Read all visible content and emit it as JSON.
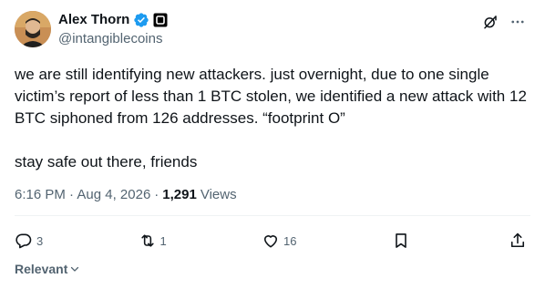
{
  "author": {
    "display_name": "Alex Thorn",
    "handle": "@intangiblecoins",
    "verified": true,
    "avatar_icon": "avatar-photo"
  },
  "tweet": {
    "paragraphs": [
      "we are still identifying new attackers. just overnight, due to one single victim’s report of less than 1 BTC stolen, we identified a new attack with 12 BTC siphoned from 126 addresses. “footprint O”",
      "stay safe out there, friends"
    ],
    "time": "6:16 PM",
    "date": "Aug 4, 2026",
    "separator": "·",
    "views_count": "1,291",
    "views_label": "Views"
  },
  "actions": {
    "replies": "3",
    "reposts": "1",
    "likes": "16"
  },
  "sort": {
    "label": "Relevant"
  },
  "colors": {
    "text": "#0f1419",
    "secondary": "#536471",
    "verified": "#1d9bf0",
    "divider": "#eff3f4"
  }
}
